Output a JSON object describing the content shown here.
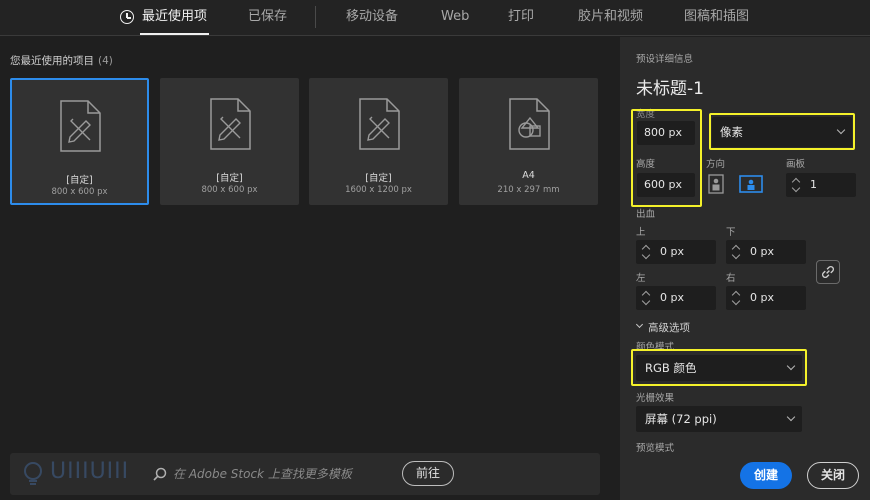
{
  "tabs": [
    {
      "label": "最近使用项",
      "active": true
    },
    {
      "label": "已保存"
    },
    {
      "label": "移动设备"
    },
    {
      "label": "Web"
    },
    {
      "label": "打印"
    },
    {
      "label": "胶片和视频"
    },
    {
      "label": "图稿和插图"
    }
  ],
  "recent": {
    "title": "您最近使用的项目",
    "count": "(4)",
    "items": [
      {
        "name": "[自定]",
        "size": "800 x 600 px",
        "icon": "brush-document-icon"
      },
      {
        "name": "[自定]",
        "size": "800 x 600 px",
        "icon": "brush-document-icon"
      },
      {
        "name": "[自定]",
        "size": "1600 x 1200 px",
        "icon": "brush-document-icon"
      },
      {
        "name": "A4",
        "size": "210 x 297 mm",
        "icon": "shapes-document-icon"
      }
    ]
  },
  "search": {
    "placeholder": "在 Adobe Stock 上查找更多模板",
    "button": "前往",
    "watermark": "UIIIUIII"
  },
  "preset": {
    "section_label": "预设详细信息",
    "title": "未标题-1",
    "width_label": "宽度",
    "width": "800 px",
    "unit": "像素",
    "height_label": "高度",
    "height": "600 px",
    "orientation_label": "方向",
    "artboard_label": "画板",
    "artboard_value": "1",
    "bleed_label": "出血",
    "top_label": "上",
    "bottom_label": "下",
    "left_label": "左",
    "right_label": "右",
    "bleed_top": "0 px",
    "bleed_bottom": "0 px",
    "bleed_left": "0 px",
    "bleed_right": "0 px",
    "advanced_label": "高级选项",
    "color_mode_label": "颜色模式",
    "color_mode": "RGB 颜色",
    "raster_label": "光栅效果",
    "raster": "屏幕 (72 ppi)",
    "preview_label": "预览模式"
  },
  "actions": {
    "create": "创建",
    "close": "关闭"
  },
  "colors": {
    "accent": "#1473e6",
    "highlight": "#f4f12a",
    "selected_border": "#2d8ceb"
  }
}
